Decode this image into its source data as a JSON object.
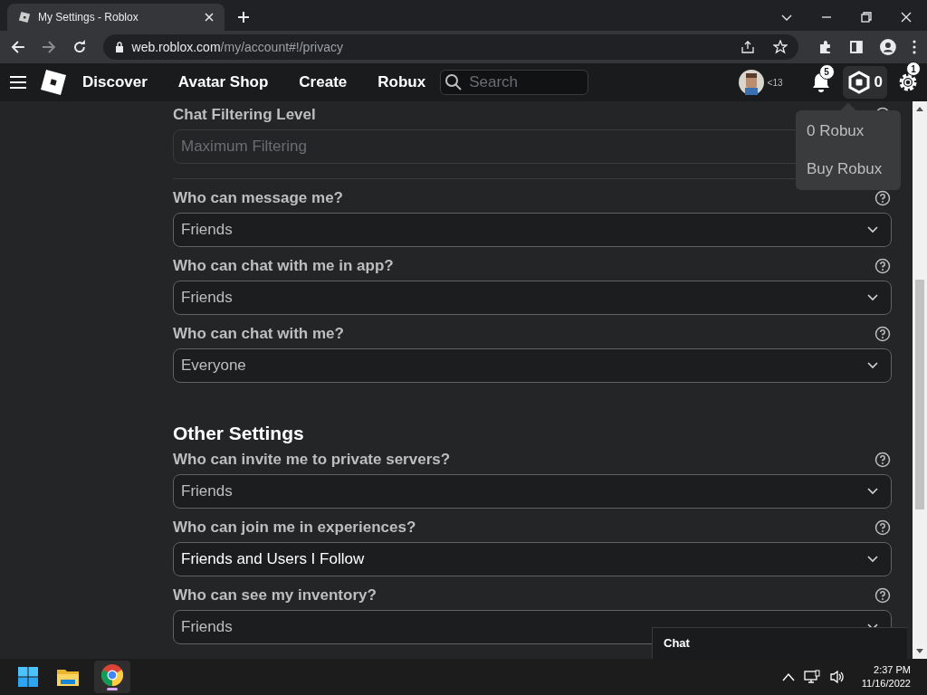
{
  "browser": {
    "tab_title": "My Settings - Roblox",
    "url_host": "web.roblox.com",
    "url_path": "/my/account#!/privacy"
  },
  "nav": {
    "links": [
      "Discover",
      "Avatar Shop",
      "Create",
      "Robux"
    ],
    "search": {
      "placeholder": "Search"
    },
    "age_label": "<13",
    "notification_count": "5",
    "robux_balance": "0",
    "settings_badge": "1"
  },
  "robux_menu": [
    "0 Robux",
    "Buy Robux"
  ],
  "sections": [
    {
      "items": [
        {
          "label": "Chat Filtering Level",
          "value": "Maximum Filtering",
          "disabled": true,
          "highlighted": false
        }
      ]
    },
    {
      "items": [
        {
          "label": "Who can message me?",
          "value": "Friends",
          "disabled": false,
          "highlighted": false
        },
        {
          "label": "Who can chat with me in app?",
          "value": "Friends",
          "disabled": false,
          "highlighted": false
        },
        {
          "label": "Who can chat with me?",
          "value": "Everyone",
          "disabled": false,
          "highlighted": false
        }
      ]
    },
    {
      "heading": "Other Settings",
      "items": [
        {
          "label": "Who can invite me to private servers?",
          "value": "Friends",
          "disabled": false,
          "highlighted": false
        },
        {
          "label": "Who can join me in experiences?",
          "value": "Friends and Users I Follow",
          "disabled": false,
          "highlighted": true
        },
        {
          "label": "Who can see my inventory?",
          "value": "Friends",
          "disabled": false,
          "highlighted": false
        }
      ]
    }
  ],
  "chat_panel": {
    "title": "Chat"
  },
  "taskbar": {
    "time": "2:37 PM",
    "date": "11/16/2022"
  }
}
